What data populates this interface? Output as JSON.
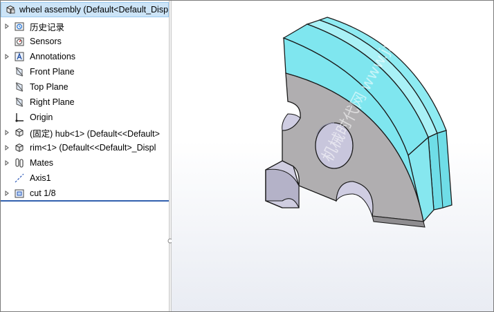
{
  "tree": {
    "root": {
      "label": "wheel assembly  (Default<Default_Disp",
      "icon": "assembly-icon"
    },
    "items": [
      {
        "label": "历史记录",
        "icon": "history-icon",
        "expandable": true
      },
      {
        "label": "Sensors",
        "icon": "sensors-icon",
        "expandable": false
      },
      {
        "label": "Annotations",
        "icon": "annotations-icon",
        "expandable": true
      },
      {
        "label": "Front Plane",
        "icon": "plane-icon",
        "expandable": false
      },
      {
        "label": "Top Plane",
        "icon": "plane-icon",
        "expandable": false
      },
      {
        "label": "Right Plane",
        "icon": "plane-icon",
        "expandable": false
      },
      {
        "label": "Origin",
        "icon": "origin-icon",
        "expandable": false
      },
      {
        "label": "(固定) hub<1> (Default<<Default>",
        "icon": "part-icon",
        "expandable": true
      },
      {
        "label": "rim<1> (Default<<Default>_Displ",
        "icon": "part-icon",
        "expandable": true
      },
      {
        "label": "Mates",
        "icon": "mates-icon",
        "expandable": true
      },
      {
        "label": "Axis1",
        "icon": "axis-icon",
        "expandable": false
      },
      {
        "label": "cut 1/8",
        "icon": "cut-feature-icon",
        "expandable": true
      }
    ]
  },
  "viewport": {
    "watermark": "机械时代网 www.jxage.com"
  },
  "colors": {
    "selection_bg": "#cce4f7",
    "divider": "#2f5fae",
    "rim_face": "#7fe6ef",
    "hub_face": "#b0aeb0",
    "outline": "#1a1a1a"
  }
}
